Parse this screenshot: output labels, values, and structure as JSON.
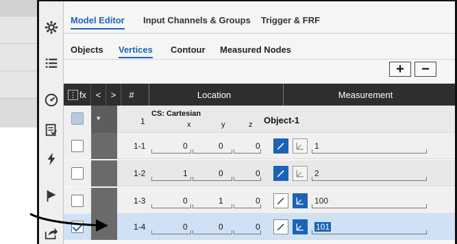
{
  "tabs_primary": [
    {
      "label": "Model Editor",
      "active": true
    },
    {
      "label": "Input Channels & Groups",
      "active": false
    },
    {
      "label": "Trigger & FRF",
      "active": false
    }
  ],
  "tabs_secondary": [
    {
      "label": "Objects",
      "active": false
    },
    {
      "label": "Vertices",
      "active": true
    },
    {
      "label": "Contour",
      "active": false
    },
    {
      "label": "Measured Nodes",
      "active": false
    }
  ],
  "toolbar": {
    "add_label": "+",
    "remove_label": "−"
  },
  "icons": [
    "gear-icon",
    "list-icon",
    "gauge-icon",
    "report-icon",
    "lightning-icon",
    "flag-icon",
    "export-icon"
  ],
  "grid_header": {
    "fx": "fx",
    "prev": "<",
    "next": ">",
    "hash": "#",
    "location": "Location",
    "measurement": "Measurement"
  },
  "group_row": {
    "index": "1",
    "cs": "CS: Cartesian",
    "x": "x",
    "y": "y",
    "z": "z",
    "object": "Object-1"
  },
  "rows": [
    {
      "id": "1-1",
      "x": "0",
      "y": "0",
      "z": "0",
      "wand_on": true,
      "meas_on": false,
      "measurement": "1",
      "checked": false
    },
    {
      "id": "1-2",
      "x": "1",
      "y": "0",
      "z": "0",
      "wand_on": true,
      "meas_on": false,
      "measurement": "2",
      "checked": false
    },
    {
      "id": "1-3",
      "x": "0",
      "y": "1",
      "z": "0",
      "wand_on": false,
      "meas_on": true,
      "measurement": "100",
      "checked": false
    },
    {
      "id": "1-4",
      "x": "0",
      "y": "0",
      "z": "0",
      "wand_on": false,
      "meas_on": true,
      "measurement": "101",
      "checked": true
    }
  ],
  "colors": {
    "accent": "#1a63b8",
    "header": "#2e2e2e"
  }
}
